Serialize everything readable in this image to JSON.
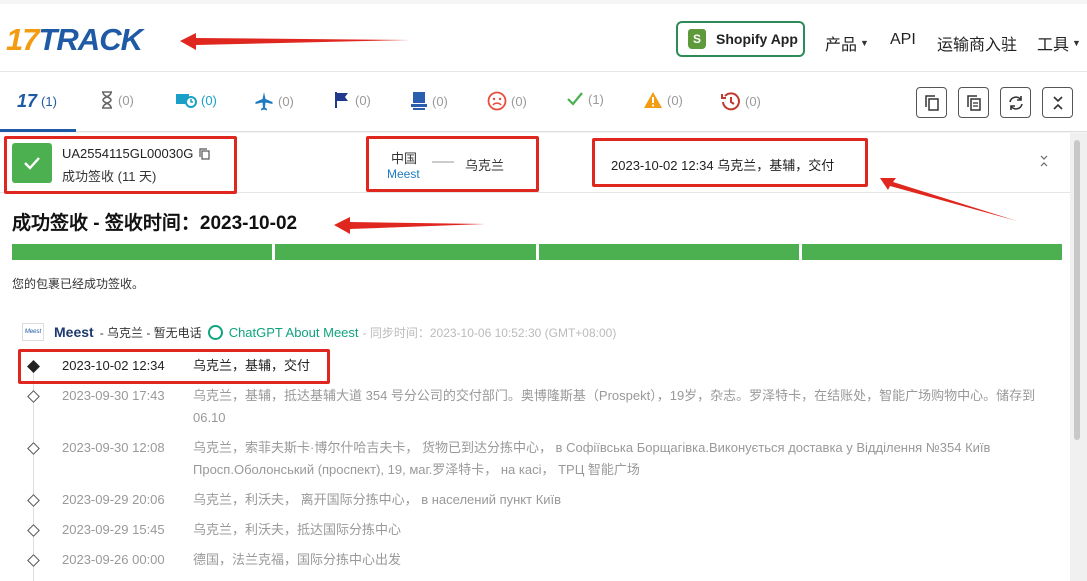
{
  "header": {
    "logo_17": "17",
    "logo_track": "TRACK",
    "shopify_label": "Shopify App",
    "nav": [
      {
        "label": "产品",
        "caret": true
      },
      {
        "label": "API",
        "caret": false
      },
      {
        "label": "运输商入驻",
        "caret": false
      },
      {
        "label": "工具",
        "caret": true
      }
    ]
  },
  "tabs": [
    {
      "icon": "17-logo-icon",
      "count": "(1)"
    },
    {
      "icon": "hourglass-icon",
      "count": "(0)"
    },
    {
      "icon": "truck-clock-icon",
      "count": "(0)"
    },
    {
      "icon": "airplane-icon",
      "count": "(0)"
    },
    {
      "icon": "flag-icon",
      "count": "(0)"
    },
    {
      "icon": "pickup-icon",
      "count": "(0)"
    },
    {
      "icon": "sad-face-icon",
      "count": "(0)"
    },
    {
      "icon": "checkmark-icon",
      "count": "(1)"
    },
    {
      "icon": "warning-icon",
      "count": "(0)"
    },
    {
      "icon": "history-icon",
      "count": "(0)"
    }
  ],
  "colors": {
    "brand_blue": "#1f5aa6",
    "brand_orange": "#f39c12",
    "success_green": "#4caf50",
    "annotation_red": "#e0271f"
  },
  "shipment": {
    "tracking_number": "UA2554115GL00030G",
    "status": "成功签收 (11 天)",
    "origin": "中国",
    "carrier_short": "Meest",
    "destination": "乌克兰",
    "latest_event": "2023-10-02 12:34  乌克兰，基辅，交付",
    "headline": "成功签收 - 签收时间：2023-10-02",
    "message": "您的包裹已经成功签收。"
  },
  "carrier": {
    "logo_text": "Meest",
    "name": "Meest",
    "info": "- 乌克兰 - 暂无电话",
    "gpt_label": "ChatGPT About Meest",
    "sync_time": "- 同步时间：2023-10-06 10:52:30 (GMT+08:00)"
  },
  "events": [
    {
      "time": "2023-10-02 12:34",
      "desc": "乌克兰，基辅，交付"
    },
    {
      "time": "2023-09-30 17:43",
      "desc": "乌克兰，基辅，抵达基辅大道 354 号分公司的交付部门。奥博隆斯基（Prospekt），19岁，杂志。罗泽特卡，在结账处，智能广场购物中心。储存到 06.10"
    },
    {
      "time": "2023-09-30 12:08",
      "desc": "乌克兰，索菲夫斯卡·博尔什哈吉夫卡， 货物已到达分拣中心， в Софіївська Борщагівка.Виконується доставка у Відділення №354 Київ Просп.Оболонський (проспект), 19, маг.罗泽特卡， на касі， ТРЦ 智能广场"
    },
    {
      "time": "2023-09-29 20:06",
      "desc": "乌克兰，利沃夫， 离开国际分拣中心， в населений пункт Київ"
    },
    {
      "time": "2023-09-29 15:45",
      "desc": "乌克兰，利沃夫，抵达国际分拣中心"
    },
    {
      "time": "2023-09-26 00:00",
      "desc": "德国，法兰克福，国际分拣中心出发"
    }
  ]
}
